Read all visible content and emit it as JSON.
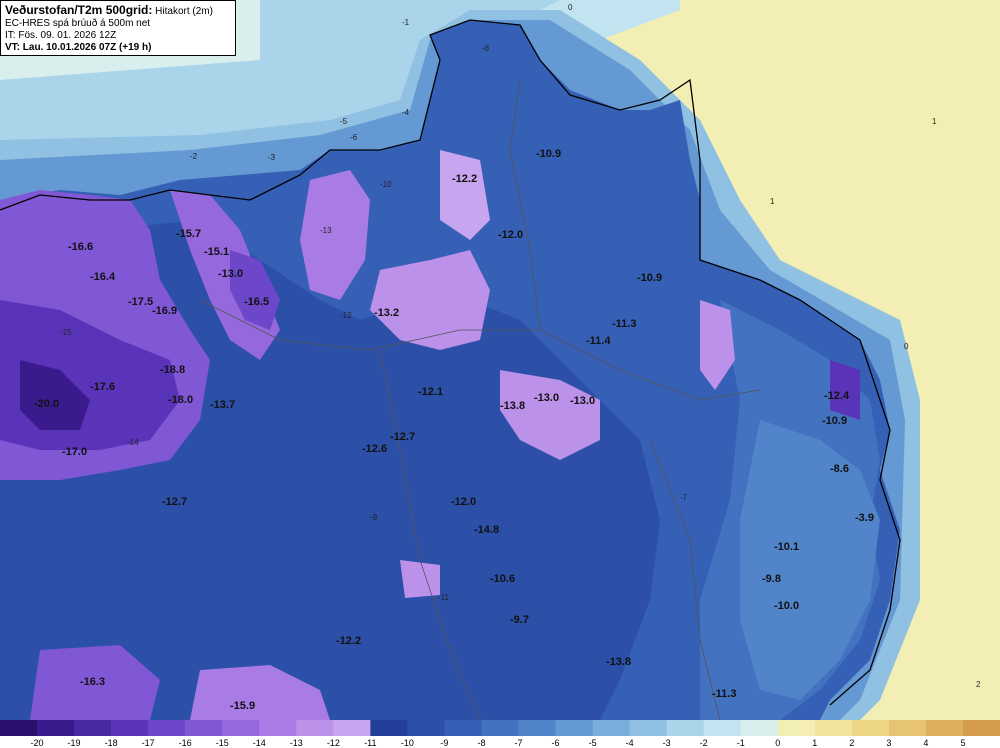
{
  "header": {
    "title": "Veðurstofan/T2m 500grid:",
    "subtitle": "Hitakort (2m)",
    "model": "EC-HRES spá brúuð á 500m net",
    "init_time": "IT: Fös. 09. 01. 2026 12Z",
    "valid_time": "VT: Lau. 10.01.2026 07Z (+19 h)"
  },
  "legend": {
    "ticks": [
      "-20",
      "-19",
      "-18",
      "-17",
      "-16",
      "-15",
      "-14",
      "-13",
      "-12",
      "-11",
      "-10",
      "-9",
      "-8",
      "-7",
      "-6",
      "-5",
      "-4",
      "-3",
      "-2",
      "-1",
      "0",
      "1",
      "2",
      "3",
      "4",
      "5"
    ],
    "colors": [
      "#2a0f6e",
      "#3a1a8c",
      "#4a27a3",
      "#5a34b8",
      "#6d47c9",
      "#8058d6",
      "#9568de",
      "#a97be4",
      "#bb91ea",
      "#c8a6ef",
      "#243f99",
      "#2c4fa8",
      "#3660b5",
      "#4372c0",
      "#5284c9",
      "#6599d3",
      "#79addb",
      "#90c1e3",
      "#a9d4ea",
      "#c2e3f0",
      "#d9efee",
      "#f3eeb4",
      "#f1e39a",
      "#eed687",
      "#e7c374",
      "#deae5f",
      "#d49a4d"
    ]
  },
  "map_labels": [
    {
      "value": "-16.6"
    },
    {
      "value": "-16.4"
    },
    {
      "value": "-17.5"
    },
    {
      "value": "-16.9"
    },
    {
      "value": "-17.6"
    },
    {
      "value": "-20.0"
    },
    {
      "value": "-18.8"
    },
    {
      "value": "-18.0"
    },
    {
      "value": "-17.0"
    },
    {
      "value": "-15.7"
    },
    {
      "value": "-15.1"
    },
    {
      "value": "-13.0"
    },
    {
      "value": "-16.5"
    },
    {
      "value": "-13.7"
    },
    {
      "value": "-12.7"
    },
    {
      "value": "-13.2"
    },
    {
      "value": "-12.2"
    },
    {
      "value": "-12.0"
    },
    {
      "value": "-10.9"
    },
    {
      "value": "-10.9"
    },
    {
      "value": "-11.3"
    },
    {
      "value": "-11.4"
    },
    {
      "value": "-12.1"
    },
    {
      "value": "-13.8"
    },
    {
      "value": "-13.0"
    },
    {
      "value": "-13.0"
    },
    {
      "value": "-12.6"
    },
    {
      "value": "-12.7"
    },
    {
      "value": "-12.0"
    },
    {
      "value": "-14.8"
    },
    {
      "value": "-10.6"
    },
    {
      "value": "-9.7"
    },
    {
      "value": "-12.2"
    },
    {
      "value": "-13.8"
    },
    {
      "value": "-16.3"
    },
    {
      "value": "-15.9"
    },
    {
      "value": "-11.3"
    },
    {
      "value": "-12.4"
    },
    {
      "value": "-10.9"
    },
    {
      "value": "-8.6"
    },
    {
      "value": "-3.9"
    },
    {
      "value": "-10.1"
    },
    {
      "value": "-9.8"
    },
    {
      "value": "-10.0"
    }
  ],
  "contour_labels": [
    {
      "value": "-1"
    },
    {
      "value": "-2"
    },
    {
      "value": "-3"
    },
    {
      "value": "-4"
    },
    {
      "value": "-5"
    },
    {
      "value": "-6"
    },
    {
      "value": "-8"
    },
    {
      "value": "-10"
    },
    {
      "value": "-12"
    },
    {
      "value": "-13"
    },
    {
      "value": "-14"
    },
    {
      "value": "-15"
    },
    {
      "value": "0"
    },
    {
      "value": "1"
    },
    {
      "value": "2"
    },
    {
      "value": "-9"
    },
    {
      "value": "-11"
    },
    {
      "value": "-7"
    },
    {
      "value": "0"
    },
    {
      "value": "1"
    }
  ]
}
